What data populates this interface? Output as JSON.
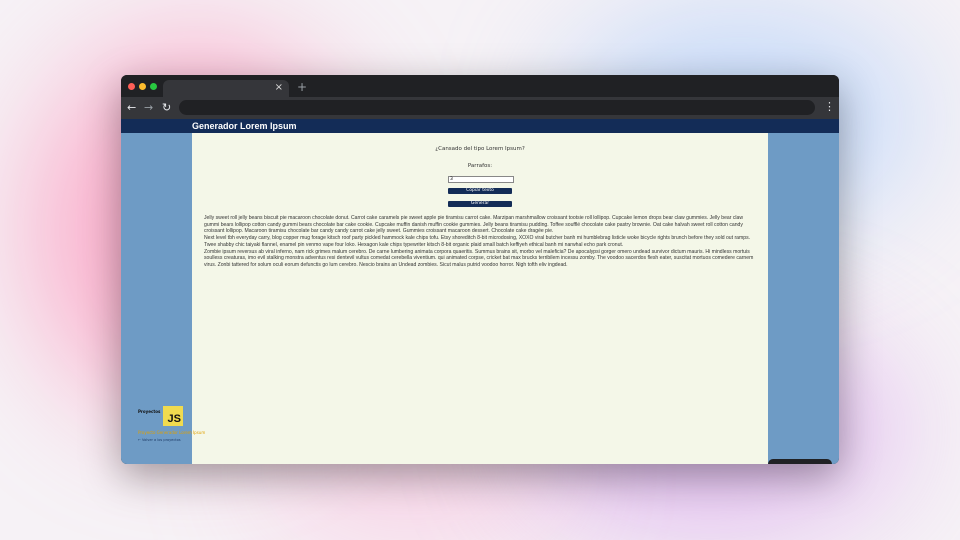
{
  "browser": {
    "tab_close_glyph": "×",
    "new_tab_glyph": "+",
    "back_glyph": "←",
    "forward_glyph": "→",
    "reload_glyph": "↻",
    "menu_glyph": "⋮"
  },
  "app": {
    "title": "Generador Lorem Ipsum",
    "question": "¿Cansado del tipo Lorem Ipsum?",
    "paragraphs_label": "Parrafos:",
    "paragraphs_value": "3",
    "copy_button": "Copiar texto",
    "generate_button": "Generar",
    "lorem": [
      "Jelly sweet roll jelly beans biscuit pie macaroon chocolate donut. Carrot cake caramels pie sweet apple pie tiramisu carrot cake. Marzipan marshmallow croissant tootsie roll lollipop. Cupcake lemon drops bear claw gummies. Jelly bear claw gummi bears lollipop cotton candy gummi bears chocolate bar cake cookie. Cupcake muffin danish muffin cookie gummies. Jelly beans tiramisu pudding. Toffee soufflé chocolate cake pastry brownie. Oat cake halvah sweet roll cotton candy croissant lollipop. Macaroon tiramisu chocolate bar candy candy carrot cake jelly sweet. Gummies croissant macaroon dessert. Chocolate cake dragée pie.",
      "Next level tbh everyday carry, blog copper mug forage kitsch roof party pickled hammock kale chips tofu. Etsy shoreditch 8-bit microdosing, XOXO viral butcher banh mi humblebrag listicle woke bicycle rights brunch before they sold out ramps. Twee shabby chic taiyaki flannel, enamel pin venmo vape four loko. Hexagon kale chips typewriter kitsch 8-bit organic plaid small batch keffiyeh ethical banh mi narwhal echo park cronut.",
      "Zombie ipsum reversus ab viral inferno, nam rick grimes malum cerebro. De carne lumbering animata corpora quaeritis. Summus brains sit, morbo vel maleficia? De apocalypsi gorger omero undead survivor dictum mauris. Hi mindless mortuis soulless creaturas, imo evil stalking monstra adventus resi dentevil vultus comedat cerebella viventium. qui animated corpse, cricket bat max brucks terribilem incessu zomby. The voodoo sacerdos flesh eater, suscitat mortuos comedere carnem virus. Zonbi tattered for solum oculi eorum defunctis go lum cerebro. Nescio brains an Undead zombies. Sicut malus putrid voodoo horror. Nigh tofth eliv ingdead."
    ],
    "footer": {
      "projects_label": "Proyectos",
      "logo_text": "JS",
      "project_name": "Proyecto Generador Lorem Ipsum",
      "back_link": "← Volver a los proyectos"
    }
  },
  "colors": {
    "header": "#132c57",
    "side_panels": "#6e9bc5",
    "content_bg": "#f4f7e8",
    "logo": "#f0db4f"
  }
}
